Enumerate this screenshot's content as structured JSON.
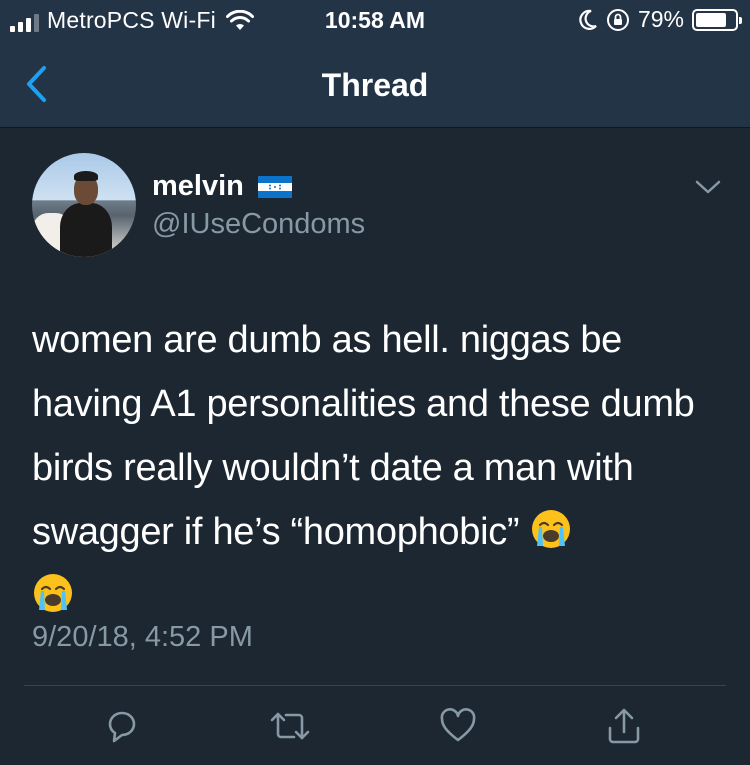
{
  "status_bar": {
    "carrier": "MetroPCS Wi-Fi",
    "time": "10:58 AM",
    "battery_percent": "79%",
    "battery_level": 0.79
  },
  "nav": {
    "title": "Thread",
    "back_icon": "chevron-left-icon"
  },
  "tweet": {
    "name": "melvin",
    "handle": "@IUseCondoms",
    "text": "women are dumb as hell. niggas be having A1 personalities and these dumb birds really wouldn’t date a man with swagger if he’s “homophobic”",
    "timestamp": "9/20/18, 4:52 PM",
    "emoji": [
      "loudly-crying-face-emoji",
      "loudly-crying-face-emoji"
    ]
  },
  "actions": [
    "reply-icon",
    "retweet-icon",
    "like-icon",
    "share-icon"
  ],
  "colors": {
    "background": "#1c2732",
    "bar": "#243447",
    "accent": "#1da1f2",
    "muted": "#8899a6"
  }
}
